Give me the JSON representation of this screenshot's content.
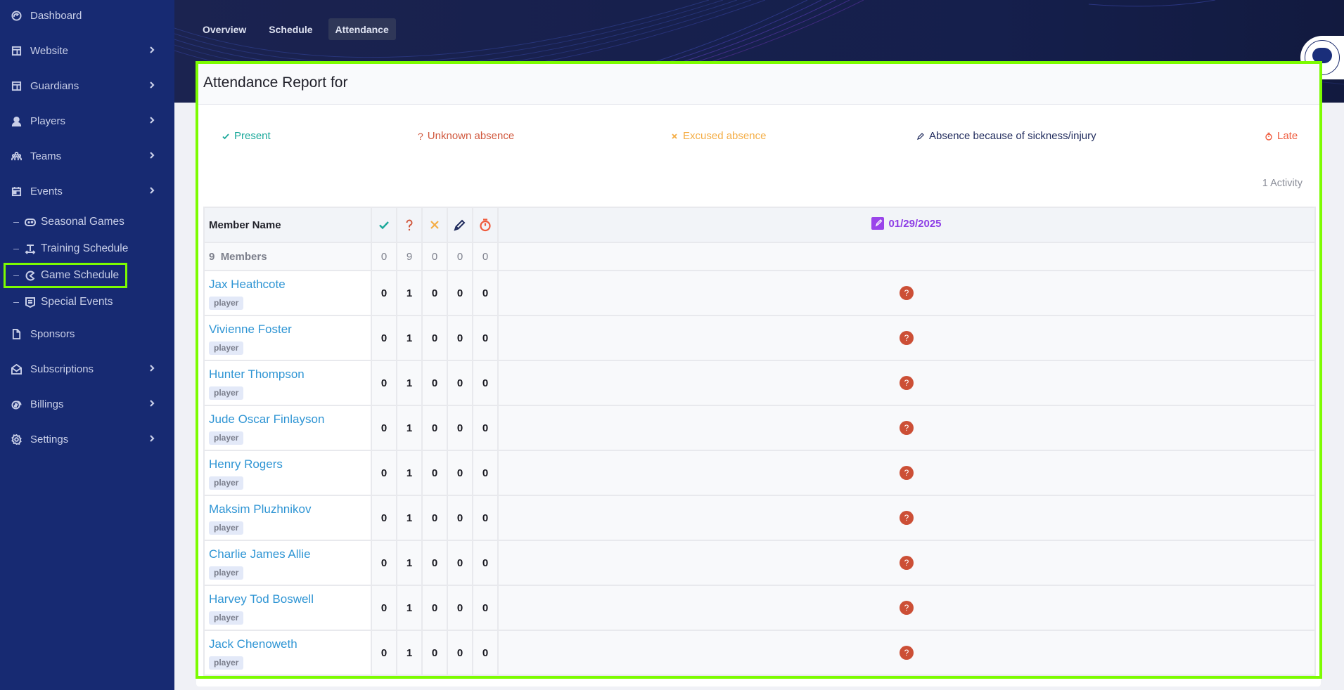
{
  "sidebar": {
    "items": [
      {
        "label": "Dashboard",
        "icon": "gauge-icon",
        "has_children": false
      },
      {
        "label": "Website",
        "icon": "layout-icon",
        "has_children": true
      },
      {
        "label": "Guardians",
        "icon": "layout-icon",
        "has_children": true
      },
      {
        "label": "Players",
        "icon": "user-icon",
        "has_children": true
      },
      {
        "label": "Teams",
        "icon": "users-group-icon",
        "has_children": true
      },
      {
        "label": "Events",
        "icon": "calendar-icon",
        "has_children": true
      }
    ],
    "sub_items": [
      {
        "label": "Seasonal Games",
        "icon": "gamepad-icon"
      },
      {
        "label": "Training Schedule",
        "icon": "training-icon"
      },
      {
        "label": "Game Schedule",
        "icon": "pacman-icon",
        "active": true
      },
      {
        "label": "Special Events",
        "icon": "shield-list-icon"
      }
    ],
    "items_bottom": [
      {
        "label": "Sponsors",
        "icon": "file-icon",
        "has_children": false
      },
      {
        "label": "Subscriptions",
        "icon": "mail-open-icon",
        "has_children": true
      },
      {
        "label": "Billings",
        "icon": "coins-icon",
        "has_children": true
      },
      {
        "label": "Settings",
        "icon": "gear-icon",
        "has_children": true
      }
    ]
  },
  "tabs": [
    {
      "label": "Overview",
      "active": false
    },
    {
      "label": "Schedule",
      "active": false
    },
    {
      "label": "Attendance",
      "active": true
    }
  ],
  "report": {
    "title": "Attendance Report for",
    "activity_count": "1 Activity",
    "legend": [
      {
        "label": "Present",
        "icon": "check-icon",
        "color": "#1aa89a"
      },
      {
        "label": "Unknown absence",
        "icon": "question-icon",
        "color": "#d0573c"
      },
      {
        "label": "Excused absence",
        "icon": "x-icon",
        "color": "#f4ad45"
      },
      {
        "label": "Absence because of sickness/injury",
        "icon": "pencil-icon",
        "color": "#1f2a5c"
      },
      {
        "label": "Late",
        "icon": "stopwatch-icon",
        "color": "#ef5a3c"
      }
    ]
  },
  "table": {
    "header_name": "Member Name",
    "date_column": "01/29/2025",
    "summary": {
      "count": "9",
      "label": "Members",
      "totals": [
        "0",
        "9",
        "0",
        "0",
        "0"
      ]
    },
    "members": [
      {
        "name": "Jax Heathcote",
        "role": "player",
        "counts": [
          "0",
          "1",
          "0",
          "0",
          "0"
        ],
        "status": "?"
      },
      {
        "name": "Vivienne Foster",
        "role": "player",
        "counts": [
          "0",
          "1",
          "0",
          "0",
          "0"
        ],
        "status": "?"
      },
      {
        "name": "Hunter Thompson",
        "role": "player",
        "counts": [
          "0",
          "1",
          "0",
          "0",
          "0"
        ],
        "status": "?"
      },
      {
        "name": "Jude Oscar Finlayson",
        "role": "player",
        "counts": [
          "0",
          "1",
          "0",
          "0",
          "0"
        ],
        "status": "?"
      },
      {
        "name": "Henry Rogers",
        "role": "player",
        "counts": [
          "0",
          "1",
          "0",
          "0",
          "0"
        ],
        "status": "?"
      },
      {
        "name": "Maksim Pluzhnikov",
        "role": "player",
        "counts": [
          "0",
          "1",
          "0",
          "0",
          "0"
        ],
        "status": "?"
      },
      {
        "name": "Charlie James Allie",
        "role": "player",
        "counts": [
          "0",
          "1",
          "0",
          "0",
          "0"
        ],
        "status": "?"
      },
      {
        "name": "Harvey Tod Boswell",
        "role": "player",
        "counts": [
          "0",
          "1",
          "0",
          "0",
          "0"
        ],
        "status": "?"
      },
      {
        "name": "Jack Chenoweth",
        "role": "player",
        "counts": [
          "0",
          "1",
          "0",
          "0",
          "0"
        ],
        "status": "?"
      }
    ]
  }
}
